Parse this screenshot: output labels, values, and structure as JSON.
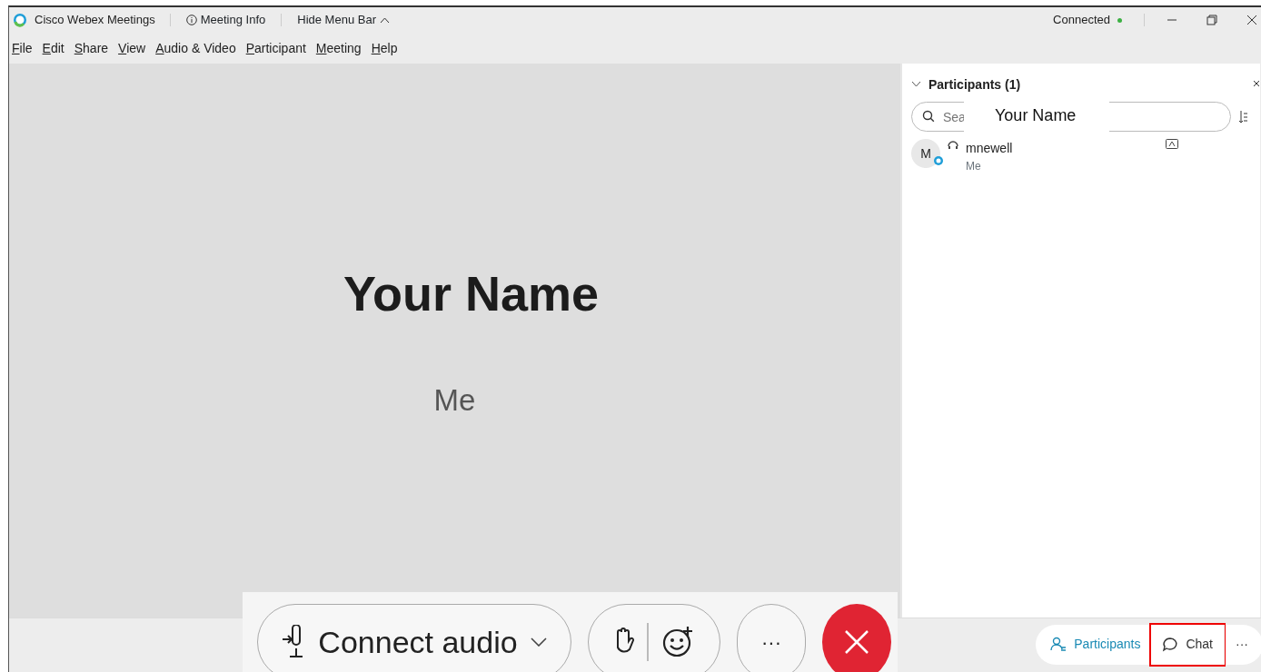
{
  "window": {
    "app_title": "Cisco Webex Meetings",
    "meeting_info": "Meeting Info",
    "hide_menu_bar": "Hide Menu Bar",
    "connection_status": "Connected",
    "connected": true
  },
  "menu": [
    "File",
    "Edit",
    "Share",
    "View",
    "Audio & Video",
    "Participant",
    "Meeting",
    "Help"
  ],
  "stage": {
    "name": "Your Name",
    "subtitle": "Me"
  },
  "panel": {
    "title": "Participants (1)",
    "expanded": true,
    "search": {
      "placeholder": "Sea"
    },
    "name_label": "Your Name",
    "participants": [
      {
        "initial": "M",
        "name": "mnewell",
        "role": "Me"
      }
    ]
  },
  "controls": {
    "connect_audio": "Connect audio",
    "more": "···"
  },
  "bottom_tabs": [
    {
      "kind": "participants",
      "label": "Participants",
      "selected": true,
      "highlighted": false
    },
    {
      "kind": "chat",
      "label": "Chat",
      "selected": false,
      "highlighted": true
    },
    {
      "kind": "more",
      "label": "···",
      "selected": false,
      "highlighted": false
    }
  ]
}
